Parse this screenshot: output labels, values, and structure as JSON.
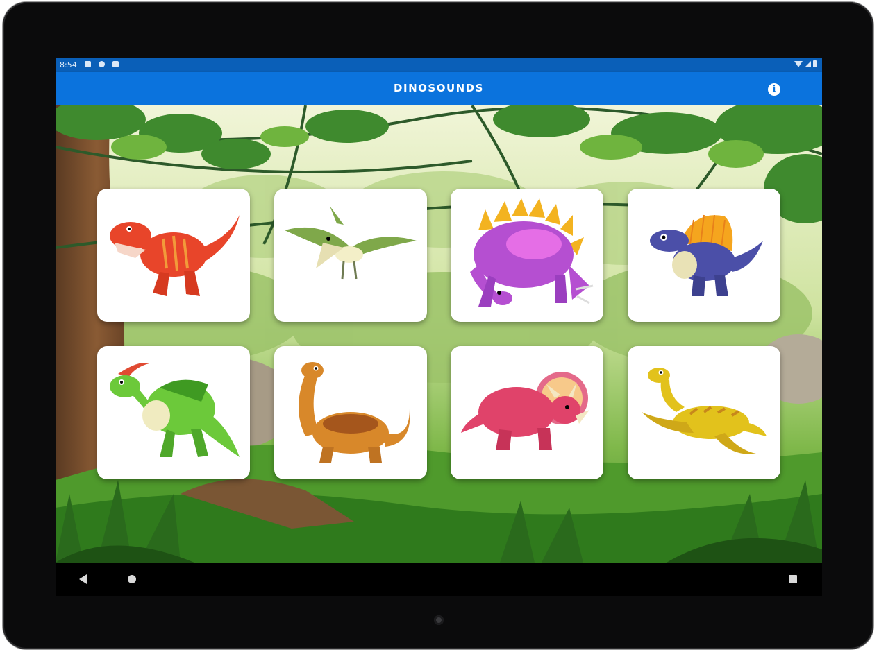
{
  "status_bar": {
    "time": "8:54",
    "left_icons": [
      "notification-a-icon",
      "notification-p-icon",
      "sd-card-icon"
    ],
    "right_icons": [
      "wifi-icon",
      "signal-icon",
      "battery-icon"
    ]
  },
  "app_bar": {
    "title": "DINOSOUNDS",
    "info_icon": "info-icon",
    "info_glyph": "i"
  },
  "dinosaur_cards": [
    {
      "dino": "tyrannosaurus",
      "color": "#e8452a"
    },
    {
      "dino": "pterodactyl",
      "color": "#7fa84a"
    },
    {
      "dino": "stegosaurus",
      "color": "#b54fd1"
    },
    {
      "dino": "spinosaurus",
      "color": "#4b4fa8"
    },
    {
      "dino": "parasaurolophus",
      "color": "#6cc93a"
    },
    {
      "dino": "brachiosaurus",
      "color": "#d8882a"
    },
    {
      "dino": "triceratops",
      "color": "#e0436a"
    },
    {
      "dino": "plesiosaurus",
      "color": "#e2c21c"
    }
  ],
  "nav_bar": {
    "buttons": [
      "back-icon",
      "home-icon",
      "recent-apps-icon"
    ]
  },
  "colors": {
    "app_bar": "#0b73dd",
    "status_bar": "#0a5fb8",
    "card": "#ffffff"
  }
}
